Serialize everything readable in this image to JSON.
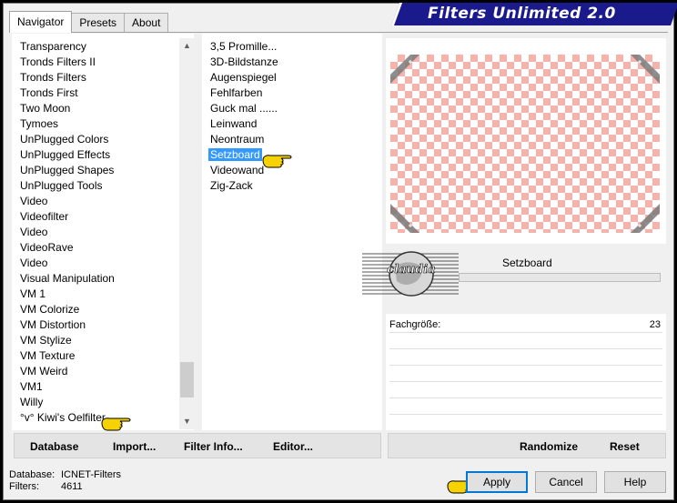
{
  "window": {
    "title": "Filters Unlimited 2.0",
    "tabs": [
      {
        "label": "Navigator"
      },
      {
        "label": "Presets"
      },
      {
        "label": "About"
      }
    ]
  },
  "categories": [
    "Transparency",
    "Tronds Filters II",
    "Tronds Filters",
    "Tronds First",
    "Two Moon",
    "Tymoes",
    "UnPlugged Colors",
    "UnPlugged Effects",
    "UnPlugged Shapes",
    "UnPlugged Tools",
    "Video",
    "Videofilter",
    "Video",
    "VideoRave",
    "Video",
    "Visual Manipulation",
    "VM 1",
    "VM Colorize",
    "VM Distortion",
    "VM Stylize",
    "VM Texture",
    "VM Weird",
    "VM1",
    "Willy",
    "°v° Kiwi's Oelfilter"
  ],
  "filters": [
    "3,5 Promille...",
    "3D-Bildstanze",
    "Augenspiegel",
    "Fehlfarben",
    "Guck mal ......",
    "Leinwand",
    "Neontraum",
    "Setzboard",
    "Videowand",
    "Zig-Zack"
  ],
  "selected_filter_index": 7,
  "scroll_position": 0.95,
  "preview": {
    "filter_name": "Setzboard",
    "checker_color": "#f7b2ac",
    "logo_text": "claudia"
  },
  "parameters": [
    {
      "label": "Fachgröße:",
      "value": "23"
    }
  ],
  "buttons": {
    "database": "Database",
    "import": "Import...",
    "filter_info": "Filter Info...",
    "editor": "Editor...",
    "randomize": "Randomize",
    "reset": "Reset",
    "apply": "Apply",
    "cancel": "Cancel",
    "help": "Help"
  },
  "info": {
    "database_label": "Database:",
    "database_value": "ICNET-Filters",
    "filters_label": "Filters:",
    "filters_value": "4611"
  },
  "colors": {
    "title_banner": "#1a1a8c",
    "selection": "#3399ff",
    "default_button_border": "#0078d7"
  }
}
